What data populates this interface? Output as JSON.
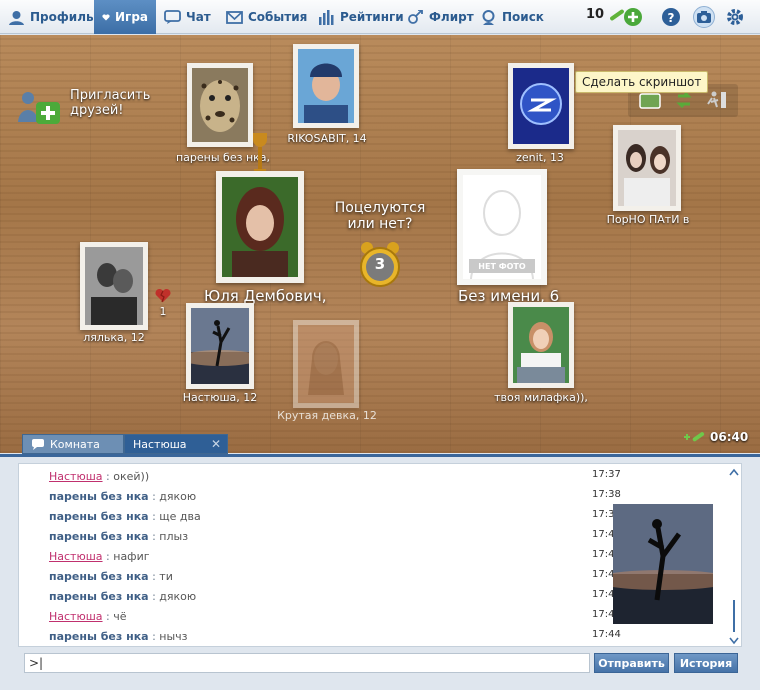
{
  "nav": {
    "items": [
      {
        "label": "Профиль",
        "icon": "user-icon"
      },
      {
        "label": "Игра",
        "icon": "heart-icon",
        "active": true
      },
      {
        "label": "Чат",
        "icon": "chat-icon"
      },
      {
        "label": "События",
        "icon": "envelope-icon"
      },
      {
        "label": "Рейтинги",
        "icon": "bars-icon"
      },
      {
        "label": "Флирт",
        "icon": "gender-icon"
      },
      {
        "label": "Поиск",
        "icon": "search-icon"
      }
    ],
    "coins": "10",
    "tooltip": "Сделать скриншот"
  },
  "game": {
    "invite": "Пригласить друзей!",
    "question": "Поцелуются или нет?",
    "timer": "3",
    "time": "06:40",
    "kiss_count": "1",
    "no_photo": "НЕТ ФОТО",
    "main_left": "Юля Дембович,",
    "main_right": "Без имени, 6",
    "players": [
      {
        "name": "парены  без  нка,"
      },
      {
        "name": "RIKOSABIT, 14"
      },
      {
        "name": "zenit, 13"
      },
      {
        "name": "ПорНО ПАтИ в"
      },
      {
        "name": "лялька, 12"
      },
      {
        "name": "Настюша, 12"
      },
      {
        "name": "Крутая девка, 12"
      },
      {
        "name": "твоя милафка)),"
      }
    ]
  },
  "tabs": [
    {
      "label": "Комната"
    },
    {
      "label": "Настюша"
    }
  ],
  "chat": {
    "messages": [
      {
        "name": "Настюша",
        "text": "окей))",
        "time": "17:37",
        "her": true
      },
      {
        "name": "парены  без  нка",
        "text": "дякою",
        "time": "17:38",
        "her": false
      },
      {
        "name": "парены  без  нка",
        "text": "ще  два",
        "time": "17:39",
        "her": false
      },
      {
        "name": "парены  без  нка",
        "text": "плыз",
        "time": "17:40",
        "her": false
      },
      {
        "name": "Настюша",
        "text": "нафиг",
        "time": "17:42",
        "her": true
      },
      {
        "name": "парены  без  нка",
        "text": "ти",
        "time": "17:43",
        "her": false
      },
      {
        "name": "парены  без  нка",
        "text": "дякою",
        "time": "17:43",
        "her": false
      },
      {
        "name": "Настюша",
        "text": "чё",
        "time": "17:43",
        "her": true
      },
      {
        "name": "парены  без  нка",
        "text": "нычз",
        "time": "17:44",
        "her": false
      }
    ],
    "input_value": ">|",
    "send_label": "Отправить",
    "history_label": "История"
  }
}
